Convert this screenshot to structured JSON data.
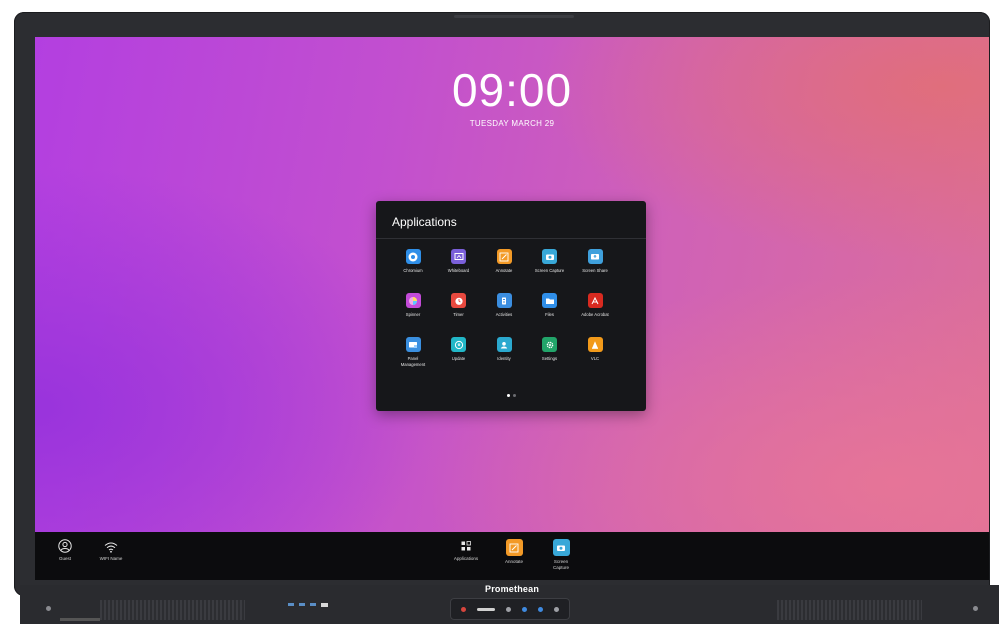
{
  "device": {
    "brand": "Promethean"
  },
  "lockscreen": {
    "time": "09:00",
    "date": "TUESDAY MARCH 29"
  },
  "apps_panel": {
    "title": "Applications",
    "page_count": 2,
    "active_page": 1,
    "apps": [
      {
        "label": "Chromium",
        "icon": "chromium-icon",
        "color": "#2f8fe8"
      },
      {
        "label": "Whiteboard",
        "icon": "whiteboard-icon",
        "color": "#7a5fd9"
      },
      {
        "label": "Annotate",
        "icon": "annotate-icon",
        "color": "#f39a27"
      },
      {
        "label": "Screen Capture",
        "icon": "camera-icon",
        "color": "#38a8d8"
      },
      {
        "label": "Screen Share",
        "icon": "screen-share-icon",
        "color": "#3fa0dc"
      },
      {
        "label": "Spinner",
        "icon": "spinner-icon",
        "color": "#c34bd8"
      },
      {
        "label": "Timer",
        "icon": "timer-icon",
        "color": "#e8493f"
      },
      {
        "label": "Activities",
        "icon": "activities-icon",
        "color": "#3b8ee0"
      },
      {
        "label": "Files",
        "icon": "folder-icon",
        "color": "#2f8ee8"
      },
      {
        "label": "Adobe Acrobat",
        "icon": "acrobat-icon",
        "color": "#d82a20"
      },
      {
        "label": "Panel Management",
        "icon": "panel-management-icon",
        "color": "#3a8fe0"
      },
      {
        "label": "Update",
        "icon": "update-icon",
        "color": "#22b7c7"
      },
      {
        "label": "Identity",
        "icon": "identity-icon",
        "color": "#2ba9cf"
      },
      {
        "label": "Settings",
        "icon": "gear-icon",
        "color": "#22a56a"
      },
      {
        "label": "VLC",
        "icon": "vlc-icon",
        "color": "#f29a1a"
      }
    ]
  },
  "taskbar": {
    "guest_label": "Guest",
    "wifi_label": "WIFI Name",
    "center": [
      {
        "label": "Applications",
        "icon": "applications-grid-icon"
      },
      {
        "label": "Annotate",
        "icon": "annotate-icon",
        "color": "#f39a27"
      },
      {
        "label": "Screen Capture",
        "icon": "camera-icon",
        "color": "#38a8d8"
      }
    ]
  }
}
